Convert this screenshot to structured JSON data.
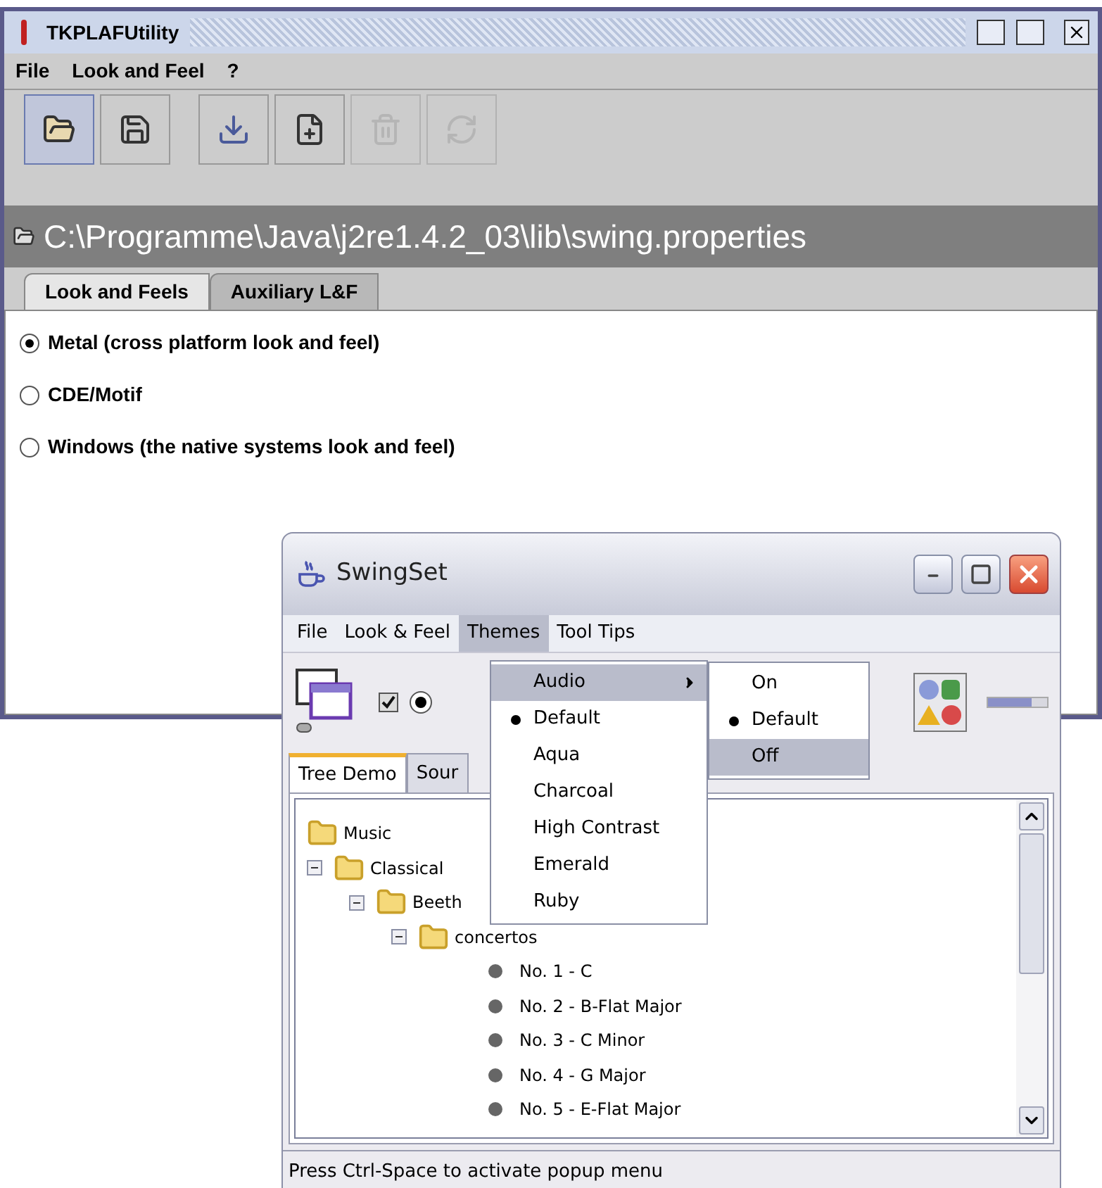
{
  "main_window": {
    "title": "TKPLAFUtility",
    "menus": [
      "File",
      "Look and Feel",
      "?"
    ],
    "toolbar": [
      {
        "kind": "open",
        "disabled": false,
        "selected": true
      },
      {
        "kind": "save",
        "disabled": false,
        "selected": false
      },
      {
        "kind": "import",
        "disabled": false,
        "selected": false
      },
      {
        "kind": "new",
        "disabled": false,
        "selected": false
      },
      {
        "kind": "delete",
        "disabled": true,
        "selected": false
      },
      {
        "kind": "refresh",
        "disabled": true,
        "selected": false
      }
    ],
    "path": "C:\\Programme\\Java\\j2re1.4.2_03\\lib\\swing.properties",
    "tabs": [
      {
        "label": "Look and Feels",
        "selected": true
      },
      {
        "label": "Auxiliary L&F",
        "selected": false
      }
    ],
    "options": [
      {
        "label": "Metal (cross platform look and feel)",
        "selected": true
      },
      {
        "label": "CDE/Motif",
        "selected": false
      },
      {
        "label": "Windows (the native systems look and feel)",
        "selected": false
      }
    ]
  },
  "swingset": {
    "title": "SwingSet",
    "menus": [
      {
        "label": "File",
        "selected": false
      },
      {
        "label": "Look & Feel",
        "selected": false
      },
      {
        "label": "Themes",
        "selected": true
      },
      {
        "label": "Tool Tips",
        "selected": false
      }
    ],
    "toolbar": {
      "checkbox_checked": true,
      "radio_selected": true,
      "progress": {
        "level": 0.73
      }
    },
    "tabs": [
      {
        "label": "Tree Demo",
        "selected": true
      },
      {
        "label": "Sour",
        "selected": false
      }
    ],
    "tree": [
      {
        "label": "Music",
        "children": [
          {
            "label": "Classical",
            "expanded": true,
            "children": [
              {
                "label": "Beeth",
                "expanded": true,
                "children": [
                  {
                    "label": "concertos",
                    "expanded": true,
                    "children": [
                      {
                        "label": "No. 1 - C"
                      },
                      {
                        "label": "No. 2 - B-Flat Major"
                      },
                      {
                        "label": "No. 3 - C Minor"
                      },
                      {
                        "label": "No. 4 - G Major"
                      },
                      {
                        "label": "No. 5 - E-Flat Major"
                      }
                    ]
                  }
                ]
              }
            ]
          }
        ]
      }
    ],
    "status": "Press Ctrl-Space to activate popup menu"
  },
  "themes_menu": {
    "items": [
      {
        "label": "Audio",
        "kind": "submenu",
        "checked": false,
        "selected": true
      },
      {
        "label": "Default",
        "kind": "radio",
        "checked": true,
        "selected": false
      },
      {
        "label": "Aqua",
        "kind": "radio",
        "checked": false,
        "selected": false
      },
      {
        "label": "Charcoal",
        "kind": "radio",
        "checked": false,
        "selected": false
      },
      {
        "label": "High Contrast",
        "kind": "radio",
        "checked": false,
        "selected": false
      },
      {
        "label": "Emerald",
        "kind": "radio",
        "checked": false,
        "selected": false
      },
      {
        "label": "Ruby",
        "kind": "radio",
        "checked": false,
        "selected": false
      }
    ]
  },
  "audio_submenu": {
    "items": [
      {
        "label": "On",
        "checked": false,
        "selected": false
      },
      {
        "label": "Default",
        "checked": true,
        "selected": false
      },
      {
        "label": "Off",
        "checked": false,
        "selected": true
      }
    ]
  }
}
